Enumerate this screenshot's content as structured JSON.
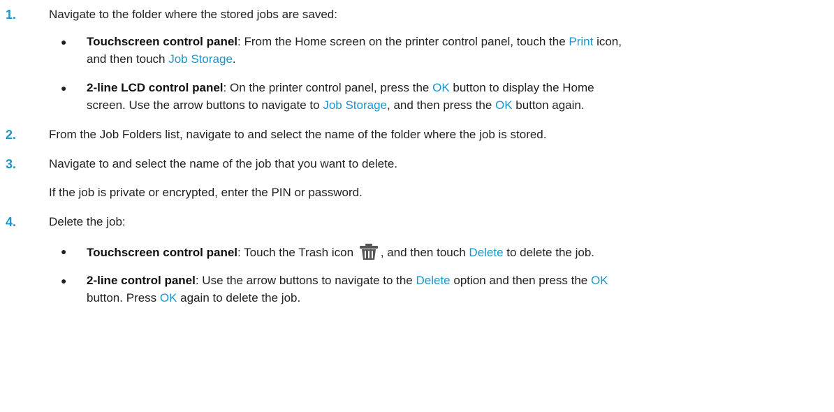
{
  "steps": [
    {
      "number": "1.",
      "text": "Navigate to the folder where the stored jobs are saved:",
      "bullets": [
        {
          "label": "Touchscreen control panel",
          "line1": [
            ": From the Home screen on the printer control panel, touch the ",
            "Print",
            " icon,"
          ],
          "line2": [
            "and then touch ",
            "Job Storage",
            "."
          ]
        },
        {
          "label": "2-line LCD control panel",
          "line1": [
            ": On the printer control panel, press the ",
            "OK",
            " button to display the Home"
          ],
          "line2": [
            "screen. Use the arrow buttons to navigate to ",
            "Job Storage",
            ", and then press the ",
            "OK",
            " button again."
          ]
        }
      ]
    },
    {
      "number": "2.",
      "text": "From the Job Folders list, navigate to and select the name of the folder where the job is stored."
    },
    {
      "number": "3.",
      "text": "Navigate to and select the name of the job that you want to delete.",
      "note": "If the job is private or encrypted, enter the PIN or password."
    },
    {
      "number": "4.",
      "text": "Delete the job:",
      "bullets": [
        {
          "label": "Touchscreen control panel",
          "line1": [
            ": Touch the Trash icon",
            ", and then touch ",
            "Delete",
            " to delete the job."
          ],
          "icon": "trash-icon"
        },
        {
          "label": "2-line control panel",
          "line1": [
            ": Use the arrow buttons to navigate to the ",
            "Delete",
            " option and then press the ",
            "OK"
          ],
          "line2": [
            "button. Press ",
            "OK",
            " again to delete the job."
          ]
        }
      ]
    }
  ],
  "colors": {
    "accent": "#1a96c9",
    "text": "#222222"
  }
}
